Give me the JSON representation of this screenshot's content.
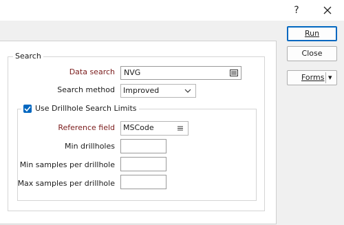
{
  "titlebar": {
    "help_label": "?",
    "close_label": "✕"
  },
  "buttons": {
    "run": "Run",
    "close": "Close",
    "forms": "Forms",
    "forms_arrow": "▾"
  },
  "search_group": {
    "title": "Search",
    "data_search_label": "Data search",
    "data_search_value": "NVG",
    "search_method_label": "Search method",
    "search_method_value": "Improved"
  },
  "drillhole_group": {
    "checkbox_label": "Use Drillhole Search Limits",
    "checked": true,
    "reference_field_label": "Reference field",
    "reference_field_value": "MSCode",
    "min_drillholes_label": "Min drillholes",
    "min_drillholes_value": "",
    "min_samples_label": "Min samples per drillhole",
    "min_samples_value": "",
    "max_samples_label": "Max samples per drillhole",
    "max_samples_value": ""
  },
  "icons": {
    "browse": "browse-list-icon",
    "dropdown": "chevron-down-icon",
    "menu": "hamburger-menu-icon"
  },
  "colors": {
    "required_label": "#7a1b1b",
    "accent": "#0067c0"
  }
}
